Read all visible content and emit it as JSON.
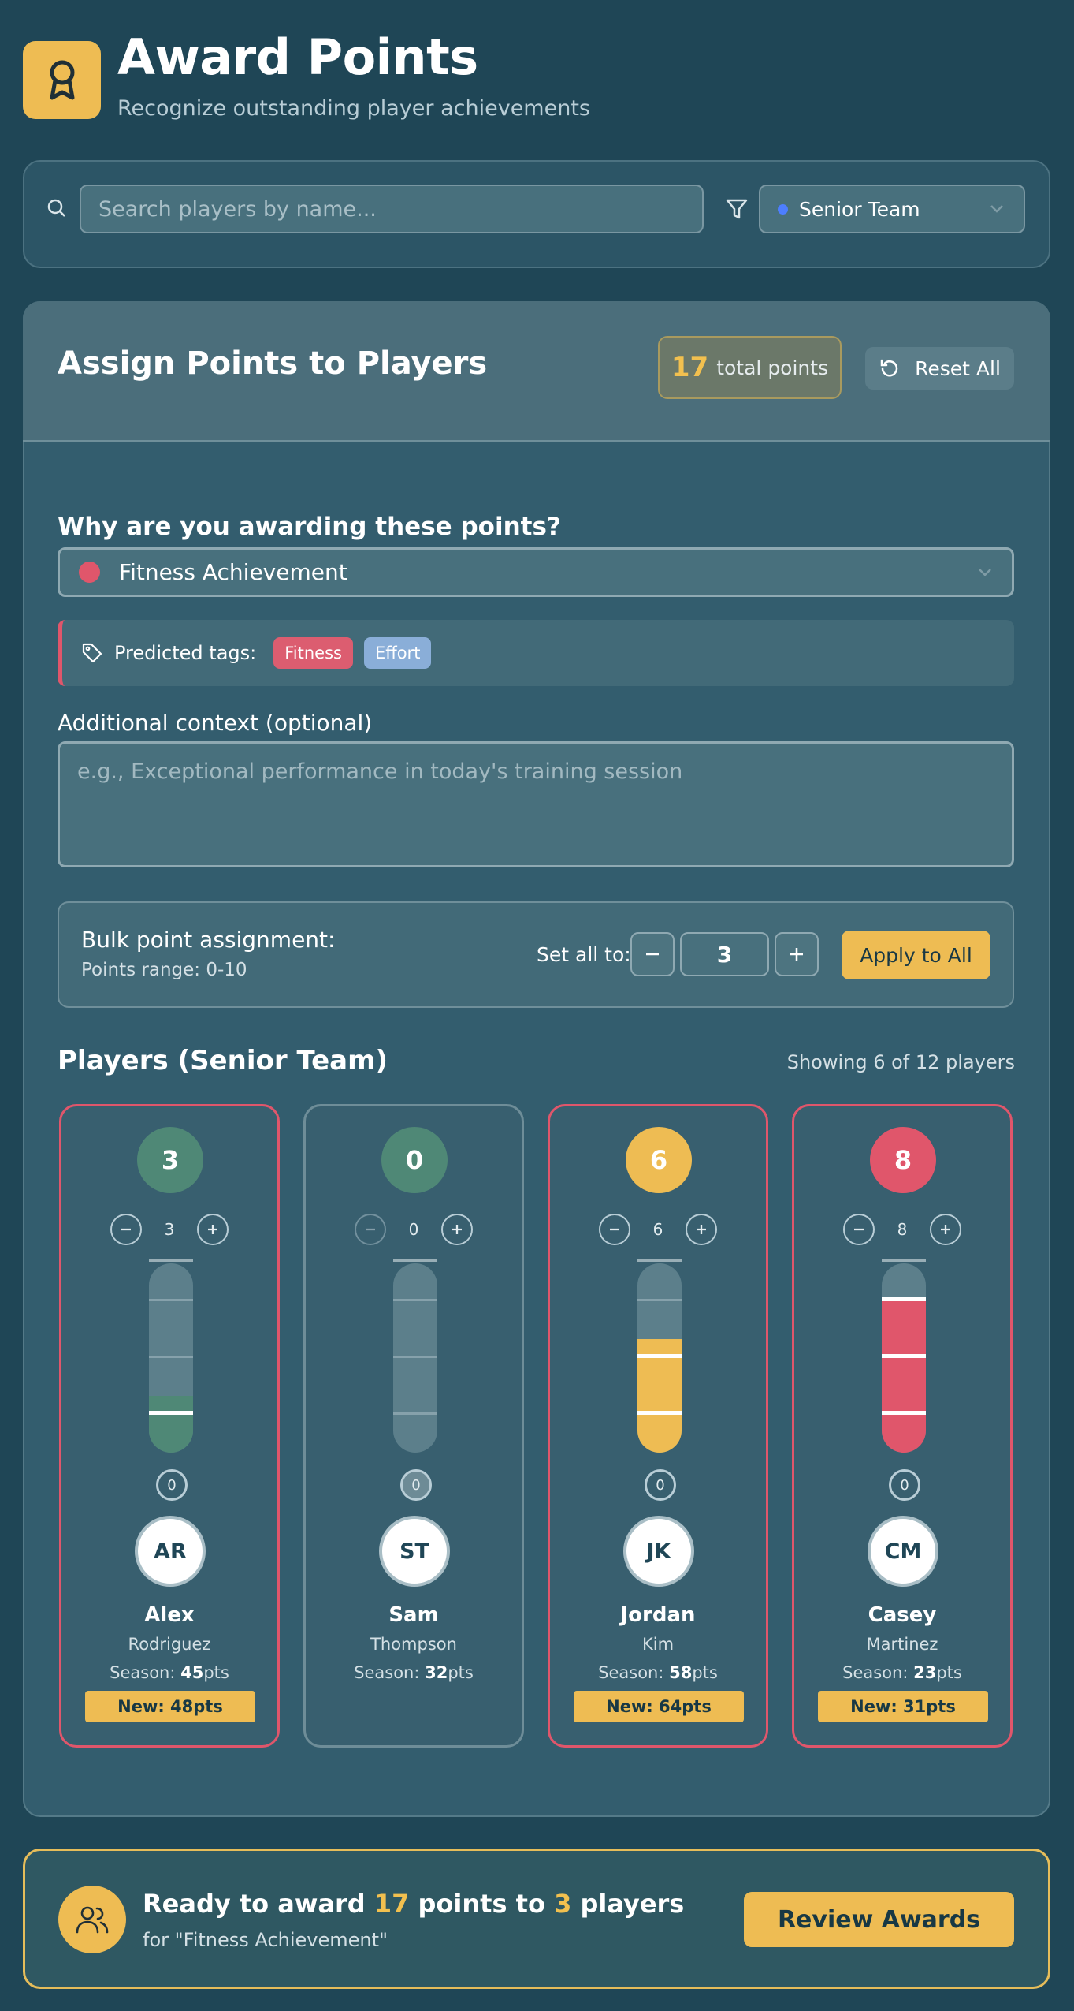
{
  "header": {
    "title": "Award Points",
    "subtitle": "Recognize outstanding player achievements"
  },
  "search": {
    "placeholder": "Search players by name...",
    "value": "",
    "team_filter": "Senior Team"
  },
  "assign": {
    "title": "Assign Points to Players",
    "total_points": "17",
    "total_label": "total points",
    "reset_label": "Reset All"
  },
  "reason": {
    "question": "Why are you awarding these points?",
    "selected": "Fitness Achievement",
    "predicted_label": "Predicted tags:",
    "tags": [
      "Fitness",
      "Effort"
    ]
  },
  "context": {
    "label": "Additional context (optional)",
    "placeholder": "e.g., Exceptional performance in today's training session"
  },
  "bulk": {
    "title": "Bulk point assignment:",
    "range": "Points range: 0-10",
    "set_all_label": "Set all to:",
    "value": "3",
    "apply_label": "Apply to All"
  },
  "players_section": {
    "title": "Players (Senior Team)",
    "count": "Showing 6 of 12 players"
  },
  "players": [
    {
      "points": "3",
      "initials": "AR",
      "first": "Alex",
      "last": "Rodriguez",
      "season_label": "Season: ",
      "season": "45",
      "season_unit": "pts",
      "new_label": "New: 48pts",
      "selected": true,
      "color": "#4f8876",
      "fill_fraction": 0.3
    },
    {
      "points": "0",
      "initials": "ST",
      "first": "Sam",
      "last": "Thompson",
      "season_label": "Season: ",
      "season": "32",
      "season_unit": "pts",
      "new_label": "",
      "selected": false,
      "color": "#4f8876",
      "fill_fraction": 0
    },
    {
      "points": "6",
      "initials": "JK",
      "first": "Jordan",
      "last": "Kim",
      "season_label": "Season: ",
      "season": "58",
      "season_unit": "pts",
      "new_label": "New: 64pts",
      "selected": true,
      "color": "#eebc53",
      "fill_fraction": 0.6
    },
    {
      "points": "8",
      "initials": "CM",
      "first": "Casey",
      "last": "Martinez",
      "season_label": "Season: ",
      "season": "23",
      "season_unit": "pts",
      "new_label": "New: 31pts",
      "selected": true,
      "color": "#e0566b",
      "fill_fraction": 0.8
    }
  ],
  "slider": {
    "zero_label": "0"
  },
  "footer": {
    "prefix": "Ready to award ",
    "points": "17",
    "middle": " points to ",
    "players": "3",
    "suffix": " players",
    "reason": "for \"Fitness Achievement\"",
    "button": "Review Awards"
  },
  "colors": {
    "background": "#1f4656",
    "accent": "#eebc53",
    "danger": "#e0566b"
  }
}
